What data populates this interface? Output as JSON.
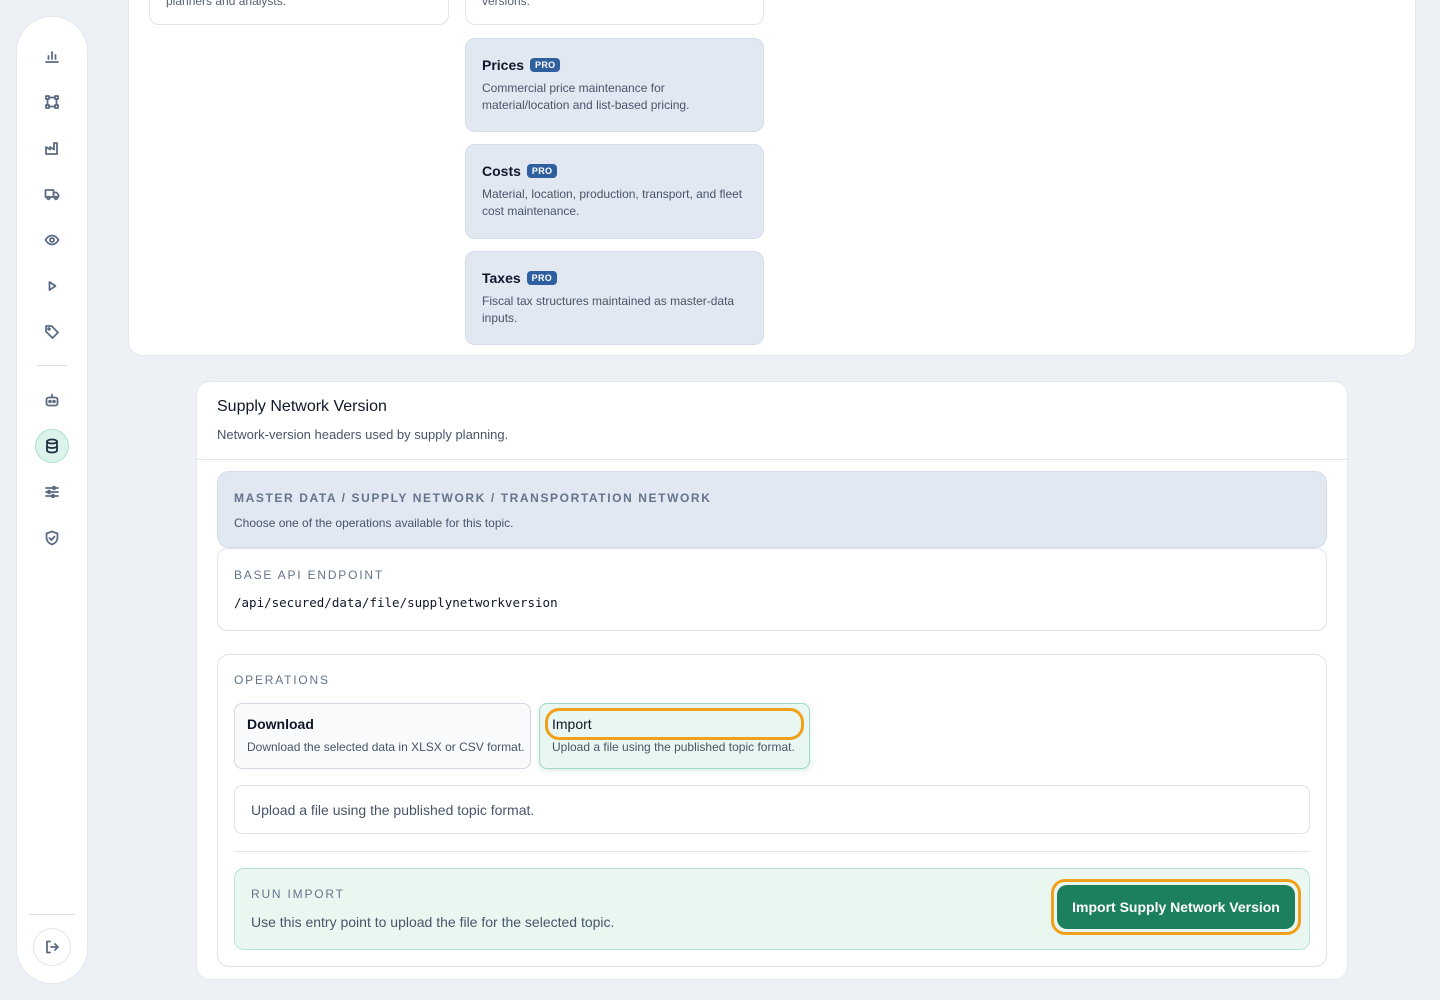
{
  "sidebar": {
    "icons": [
      "chart-bar-icon",
      "network-icon",
      "factory-icon",
      "truck-icon",
      "eye-icon",
      "play-icon",
      "tag-icon",
      "robot-icon",
      "database-icon",
      "sliders-icon",
      "shield-check-icon",
      "logout-icon"
    ],
    "active": "database-icon"
  },
  "top_panel": {
    "ghost_left_text": "planners and analysts.",
    "ghost_right_text": "versions.",
    "pro_cards": [
      {
        "title": "Prices",
        "badge": "PRO",
        "description": "Commercial price maintenance for material/location and list-based pricing."
      },
      {
        "title": "Costs",
        "badge": "PRO",
        "description": "Material, location, production, transport, and fleet cost maintenance."
      },
      {
        "title": "Taxes",
        "badge": "PRO",
        "description": "Fiscal tax structures maintained as master-data inputs."
      }
    ]
  },
  "main": {
    "title": "Supply Network Version",
    "subtitle": "Network-version headers used by supply planning.",
    "path": "MASTER DATA / SUPPLY NETWORK / TRANSPORTATION NETWORK",
    "path_hint": "Choose one of the operations available for this topic.",
    "endpoint_label": "BASE API ENDPOINT",
    "endpoint_value": "/api/secured/data/file/supplynetworkversion",
    "operations_label": "OPERATIONS",
    "operations": [
      {
        "title": "Download",
        "description": "Download the selected data in XLSX or CSV format."
      },
      {
        "title": "Import",
        "description": "Upload a file using the published topic format."
      }
    ],
    "selected_operation": "Import",
    "info_text": "Upload a file using the published topic format.",
    "run_label": "RUN IMPORT",
    "run_description": "Use this entry point to upload the file for the selected topic.",
    "run_button": "Import Supply Network Version"
  },
  "colors": {
    "accent_green": "#1c7f5d",
    "highlight_orange": "#f0a11b",
    "pro_badge": "#2f5f9e"
  }
}
